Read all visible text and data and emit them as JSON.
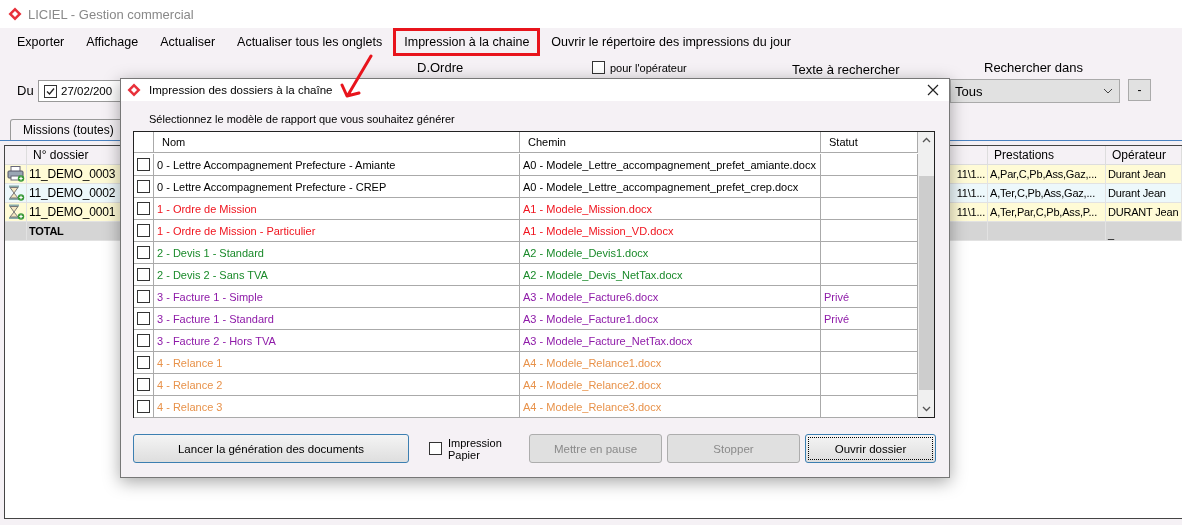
{
  "window": {
    "title": "LICIEL - Gestion commercial"
  },
  "menu": [
    {
      "label": "Exporter",
      "highlighted": false
    },
    {
      "label": "Affichage",
      "highlighted": false
    },
    {
      "label": "Actualiser",
      "highlighted": false
    },
    {
      "label": "Actualiser tous les onglets",
      "highlighted": false
    },
    {
      "label": "Impression à la chaine",
      "highlighted": true
    },
    {
      "label": "Ouvrir le répertoire des impressions du jour",
      "highlighted": false
    }
  ],
  "filters": {
    "du_label": "Du",
    "date": {
      "checked": true,
      "value": "27/02/200"
    },
    "d_ordre_label": "D.Ordre",
    "operator_filter": {
      "label": "pour l'opérateur",
      "checked": false
    },
    "search_label": "Texte à rechercher",
    "search_in_label": "Rechercher dans",
    "search_in": {
      "value": "Tous"
    },
    "clear_button": "-"
  },
  "tabs": [
    {
      "label": "Missions (toutes)",
      "selected": true
    }
  ],
  "missions": {
    "columns": {
      "dossier": "N° dossier",
      "prestations": "Prestations",
      "operateur": "Opérateur"
    },
    "rows": [
      {
        "kind": "printer",
        "dossier": "11_DEMO_0003",
        "column_3": "11\\1...",
        "prestations": "A,Par,C,Pb,Ass,Gaz,...",
        "operateur": "Durant Jean"
      },
      {
        "kind": "hourglass",
        "dossier": "11_DEMO_0002",
        "column_3": "11\\1...",
        "prestations": "A,Ter,C,Pb,Ass,Gaz,...",
        "operateur": "Durant Jean"
      },
      {
        "kind": "hourglass",
        "dossier": "11_DEMO_0001",
        "column_3": "11\\1...",
        "prestations": "A,Ter,Par,C,Pb,Ass,P...",
        "operateur": "DURANT Jean"
      }
    ],
    "total": {
      "label": "TOTAL",
      "operateur": "_"
    }
  },
  "dialog": {
    "title": "Impression des dossiers à la chaîne",
    "instruction": "Sélectionnez le modèle de rapport que vous souhaitez générer",
    "columns": [
      "Nom",
      "Chemin",
      "Statut"
    ],
    "reports": [
      {
        "nom": "0 - Lettre Accompagnement Prefecture - Amiante",
        "chemin": "A0 - Modele_Lettre_accompagnement_prefet_amiante.docx",
        "color": "#000000",
        "checked": false
      },
      {
        "nom": "0 - Lettre Accompagnement Prefecture - CREP",
        "chemin": "A0 - Modele_Lettre_accompagnement_prefet_crep.docx",
        "color": "#000000",
        "checked": false
      },
      {
        "nom": "1 - Ordre de Mission",
        "chemin": "A1 - Modele_Mission.docx",
        "color": "#f0141e",
        "checked": false
      },
      {
        "nom": "1 - Ordre de Mission - Particulier",
        "chemin": "A1 - Modele_Mission_VD.docx",
        "color": "#f0141e",
        "checked": false
      },
      {
        "nom": "2 - Devis 1 - Standard",
        "chemin": "A2 - Modele_Devis1.docx",
        "color": "#1a8a2a",
        "checked": false
      },
      {
        "nom": "2 - Devis 2 - Sans TVA",
        "chemin": "A2 - Modele_Devis_NetTax.docx",
        "color": "#1a8a2a",
        "checked": false
      },
      {
        "nom": "3 - Facture 1 - Simple",
        "chemin": "A3 - Modele_Facture6.docx",
        "statut": "Privé",
        "color": "#8e1aa8",
        "checked": false
      },
      {
        "nom": "3 - Facture 1 - Standard",
        "chemin": "A3 - Modele_Facture1.docx",
        "statut": "Privé",
        "color": "#8e1aa8",
        "checked": false
      },
      {
        "nom": "3 - Facture 2 - Hors TVA",
        "chemin": "A3 - Modele_Facture_NetTax.docx",
        "color": "#8e1aa8",
        "checked": false
      },
      {
        "nom": "4 - Relance 1",
        "chemin": "A4 - Modele_Relance1.docx",
        "color": "#e8924a",
        "checked": false
      },
      {
        "nom": "4 - Relance 2",
        "chemin": "A4 - Modele_Relance2.docx",
        "color": "#e8924a",
        "checked": false
      },
      {
        "nom": "4 - Relance 3",
        "chemin": "A4 - Modele_Relance3.docx",
        "color": "#e8924a",
        "checked": false
      }
    ],
    "launch_button": "Lancer la génération des documents",
    "paper_print": {
      "label": "Impression Papier",
      "checked": false
    },
    "buttons": [
      {
        "label": "Mettre en pause",
        "disabled": true,
        "focused": false
      },
      {
        "label": "Stopper",
        "disabled": true,
        "focused": false
      },
      {
        "label": "Ouvrir dossier",
        "disabled": false,
        "focused": true
      }
    ]
  }
}
